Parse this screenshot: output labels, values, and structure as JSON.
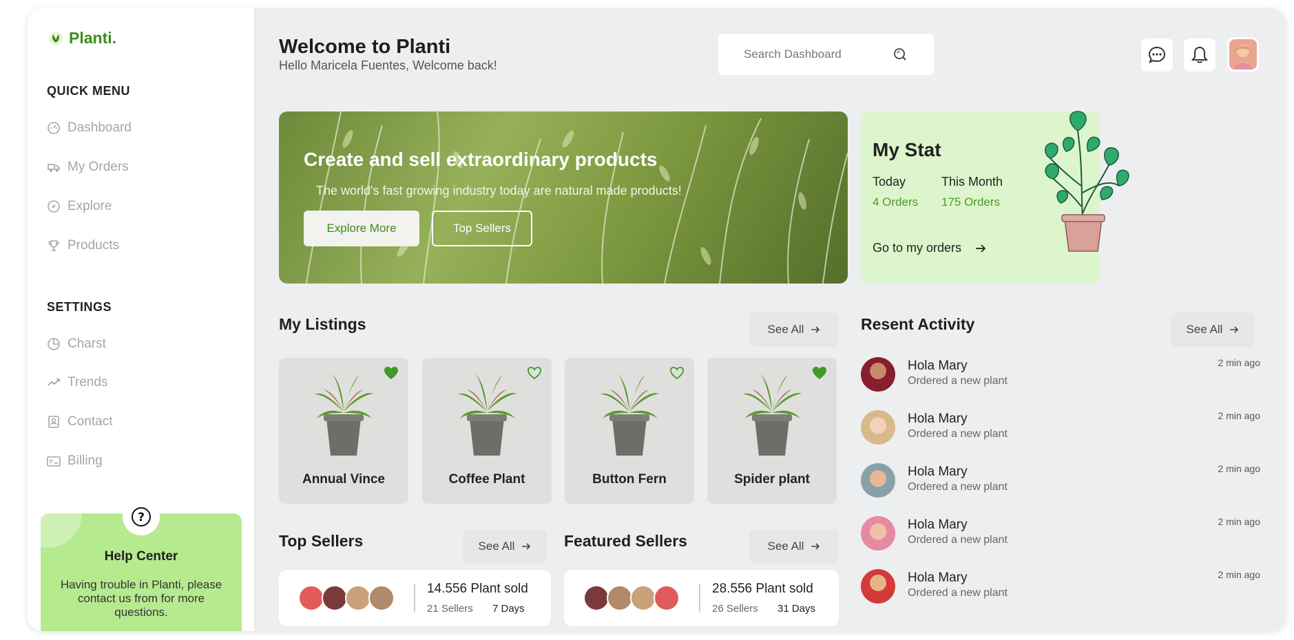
{
  "app": {
    "brand": "Planti."
  },
  "sidebar": {
    "quick_menu_title": "QUICK MENU",
    "quick_items": [
      {
        "label": "Dashboard",
        "icon": "dashboard-icon"
      },
      {
        "label": "My Orders",
        "icon": "orders-icon"
      },
      {
        "label": "Explore",
        "icon": "compass-icon"
      },
      {
        "label": "Products",
        "icon": "trophy-icon"
      }
    ],
    "settings_title": "SETTINGS",
    "settings_items": [
      {
        "label": "Charst",
        "icon": "pie-chart-icon"
      },
      {
        "label": "Trends",
        "icon": "trend-icon"
      },
      {
        "label": "Contact",
        "icon": "contact-icon"
      },
      {
        "label": "Billing",
        "icon": "billing-icon"
      }
    ],
    "help": {
      "title": "Help Center",
      "text": "Having trouble in Planti, please contact us from for more questions."
    }
  },
  "header": {
    "title": "Welcome to Planti",
    "subtitle": "Hello Maricela Fuentes, Welcome back!",
    "search_placeholder": "Search Dashboard"
  },
  "hero": {
    "title": "Create and sell extraordinary products",
    "subtitle": "The world's fast growing industry today are natural made products!",
    "primary_button": "Explore More",
    "secondary_button": "Top Sellers"
  },
  "stat": {
    "title": "My Stat",
    "today_label": "Today",
    "today_value": "4 Orders",
    "month_label": "This Month",
    "month_value": "175 Orders",
    "link": "Go to my orders"
  },
  "listings": {
    "title": "My Listings",
    "see_all": "See All",
    "items": [
      {
        "name": "Annual Vince",
        "liked": true
      },
      {
        "name": "Coffee Plant",
        "liked": false
      },
      {
        "name": "Button Fern",
        "liked": false
      },
      {
        "name": "Spider plant",
        "liked": true
      }
    ]
  },
  "top_sellers": {
    "title": "Top Sellers",
    "see_all": "See All",
    "sold": "14.556 Plant sold",
    "sellers": "21 Sellers",
    "period": "7 Days"
  },
  "featured_sellers": {
    "title": "Featured Sellers",
    "see_all": "See All",
    "sold": "28.556 Plant sold",
    "sellers": "26 Sellers",
    "period": "31 Days"
  },
  "activity": {
    "title": "Resent Activity",
    "see_all": "See All",
    "items": [
      {
        "name": "Hola Mary",
        "desc": "Ordered a new plant",
        "time": "2 min ago"
      },
      {
        "name": "Hola Mary",
        "desc": "Ordered a new plant",
        "time": "2 min ago"
      },
      {
        "name": "Hola Mary",
        "desc": "Ordered a new plant",
        "time": "2 min ago"
      },
      {
        "name": "Hola Mary",
        "desc": "Ordered a new plant",
        "time": "2 min ago"
      },
      {
        "name": "Hola Mary",
        "desc": "Ordered a new plant",
        "time": "2 min ago"
      }
    ]
  },
  "colors": {
    "brand_green": "#3d8c1e",
    "stat_bg": "#ddf5cc",
    "help_bg": "#b5ea8e"
  }
}
